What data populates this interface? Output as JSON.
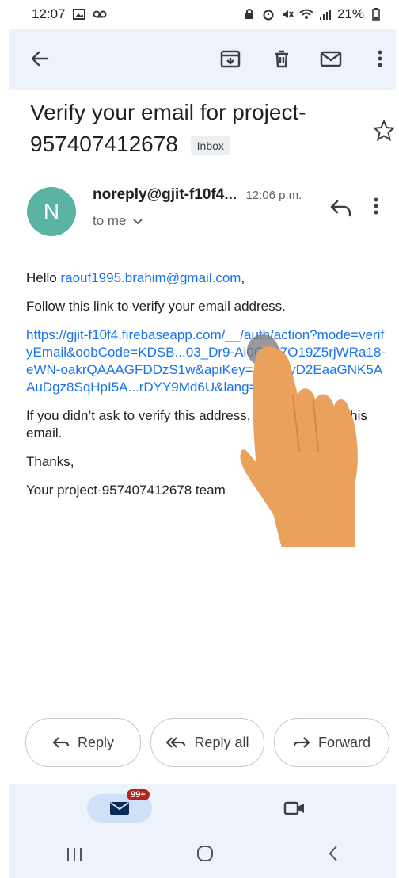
{
  "status_bar": {
    "time": "12:07",
    "battery": "21%"
  },
  "app_bar": {
    "icons": [
      "back-arrow-icon",
      "archive-icon",
      "delete-icon",
      "mail-icon",
      "more-vert-icon"
    ]
  },
  "email": {
    "subject": "Verify your email for project-957407412678",
    "label": "Inbox",
    "avatar_letter": "N",
    "sender": "noreply@gjit-f10f4...",
    "time": "12:06 p.m.",
    "to": "to me",
    "body": {
      "greeting_prefix": "Hello ",
      "greeting_email": "raouf1995.brahim@gmail.com",
      "greeting_suffix": ",",
      "instruction": "Follow this link to verify your email address.",
      "url": "https://gjit-f10f4.firebaseapp.com/__/auth/action?mode=verifyEmail&oobCode=KDSB...03_Dr9-Ai0QVJ7O19Z5rjWRa18-eWN-oakrQAAAGFDDzS1w&apiKey=AIzaSyD2EaaGNK5AAuDgz8SqHpI5A...rDYY9Md6U&lang=en",
      "ignore": "If you didn’t ask to verify this address, you can ignore this email.",
      "thanks": "Thanks,",
      "signoff": "Your project-957407412678 team"
    }
  },
  "actions": {
    "reply": "Reply",
    "reply_all": "Reply all",
    "forward": "Forward"
  },
  "bottom_nav": {
    "mail_badge": "99+"
  }
}
